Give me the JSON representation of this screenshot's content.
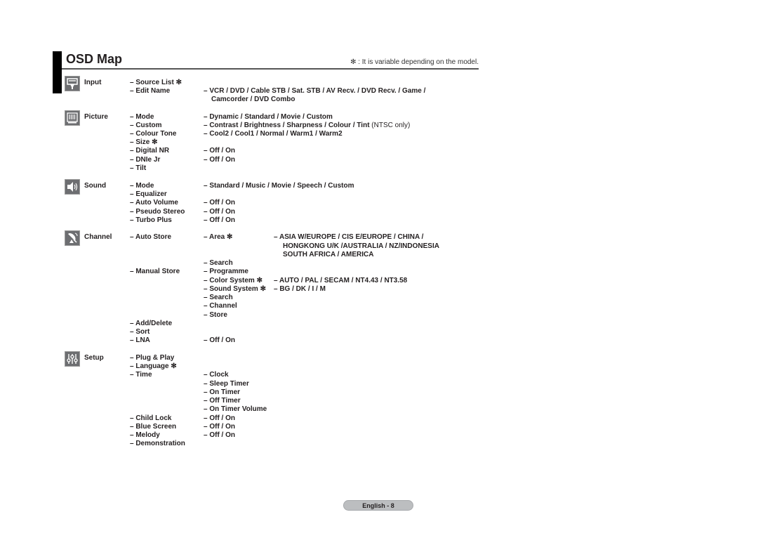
{
  "header": {
    "title": "OSD Map",
    "note": "✻ : It is variable depending on the model."
  },
  "sections": {
    "input": {
      "label": "Input",
      "icon": "input-icon",
      "items": [
        "– Source List ✻",
        "– Edit Name"
      ],
      "values": [
        "– VCR / DVD / Cable STB / Sat. STB / AV Recv. / DVD Recv. / Game /",
        "Camcorder / DVD Combo"
      ]
    },
    "picture": {
      "label": "Picture",
      "icon": "picture-icon",
      "items": [
        "– Mode",
        "– Custom",
        "– Colour Tone",
        "– Size ✻",
        "– Digital NR",
        "– DNIe Jr",
        "– Tilt"
      ],
      "values": [
        "– Dynamic / Standard / Movie / Custom",
        "– Contrast / Brightness / Sharpness / Colour / Tint",
        "– Cool2 / Cool1 / Normal / Warm1 / Warm2",
        "",
        "– Off / On",
        "– Off / On",
        ""
      ],
      "custom_suffix": " (NTSC only)"
    },
    "sound": {
      "label": "Sound",
      "icon": "speaker-icon",
      "items": [
        "– Mode",
        "– Equalizer",
        "– Auto Volume",
        "– Pseudo Stereo",
        "– Turbo Plus"
      ],
      "values": [
        "– Standard / Music / Movie / Speech / Custom",
        "",
        "– Off / On",
        "– Off / On",
        "– Off / On"
      ]
    },
    "channel": {
      "label": "Channel",
      "icon": "satellite-dish-icon",
      "auto_store": "– Auto Store",
      "area": "– Area ✻",
      "area_values": [
        "– ASIA W/EUROPE / CIS E/EUROPE / CHINA /",
        "HONGKONG U/K /AUSTRALIA / NZ/INDONESIA",
        "SOUTH AFRICA / AMERICA"
      ],
      "search": "– Search",
      "manual_store": "– Manual Store",
      "manual_items": [
        "– Programme",
        "– Color System ✻",
        "– Sound System ✻",
        "– Search",
        "– Channel",
        "– Store"
      ],
      "manual_values": [
        "",
        "– AUTO / PAL / SECAM / NT4.43 / NT3.58",
        "– BG / DK / I / M",
        "",
        "",
        ""
      ],
      "items": [
        "– Add/Delete",
        "– Sort",
        "– LNA"
      ],
      "values": [
        "",
        "",
        "– Off / On"
      ]
    },
    "setup": {
      "label": "Setup",
      "icon": "sliders-icon",
      "items": [
        "– Plug & Play",
        "– Language ✻",
        "– Time",
        "",
        "",
        "",
        "",
        "– Child Lock",
        "– Blue Screen",
        "– Melody",
        "– Demonstration"
      ],
      "values": [
        "",
        "",
        "– Clock",
        "– Sleep Timer",
        "– On Timer",
        "– Off Timer",
        "– On Timer Volume",
        "– Off / On",
        "– Off / On",
        "– Off / On",
        ""
      ]
    }
  },
  "footer": {
    "page_label": "English - 8"
  }
}
